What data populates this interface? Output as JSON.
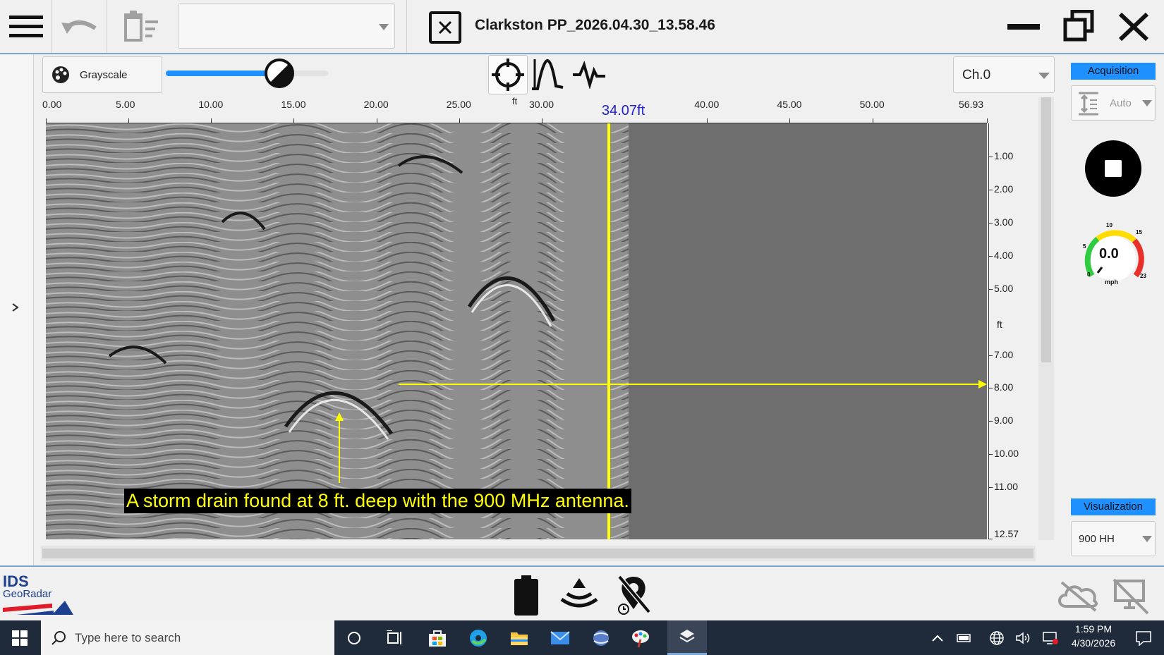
{
  "window": {
    "title": "Clarkston PP_2026.04.30_13.58.46"
  },
  "toolbar": {
    "palette_label": "Grayscale",
    "slider_level": 0.7,
    "channel_value": "Ch.0",
    "units": "ft"
  },
  "distance_axis": {
    "ticks": [
      "0.00",
      "5.00",
      "10.00",
      "15.00",
      "20.00",
      "25.00",
      "30.00",
      "40.00",
      "45.00",
      "50.00",
      "56.93"
    ],
    "cursor_label": "34.07ft",
    "units": "ft"
  },
  "depth_axis": {
    "ticks": [
      "1.00",
      "2.00",
      "3.00",
      "4.00",
      "5.00",
      "7.00",
      "8.00",
      "9.00",
      "10.00",
      "11.00",
      "12.57"
    ],
    "units": "ft"
  },
  "annotation": {
    "caption": "A storm drain found at 8 ft. deep with the 900 MHz antenna."
  },
  "right_panel": {
    "acquisition_header": "Acquisition",
    "gain_mode": "Auto",
    "speed_value": "0.0",
    "speed_unit": "mph",
    "gauge_ticks": [
      "0",
      "5",
      "10",
      "15",
      "23"
    ],
    "visualization_header": "Visualization",
    "antenna_value": "900 HH"
  },
  "statusbar": {
    "logo_top": "IDS",
    "logo_bottom": "GeoRadar"
  },
  "taskbar": {
    "search_placeholder": "Type here to search",
    "time": "1:59 PM",
    "date": "4/30/2026"
  },
  "colors": {
    "accent": "#1e90ff",
    "cursor": "#ffff00",
    "cursor_label": "#2020d0"
  }
}
